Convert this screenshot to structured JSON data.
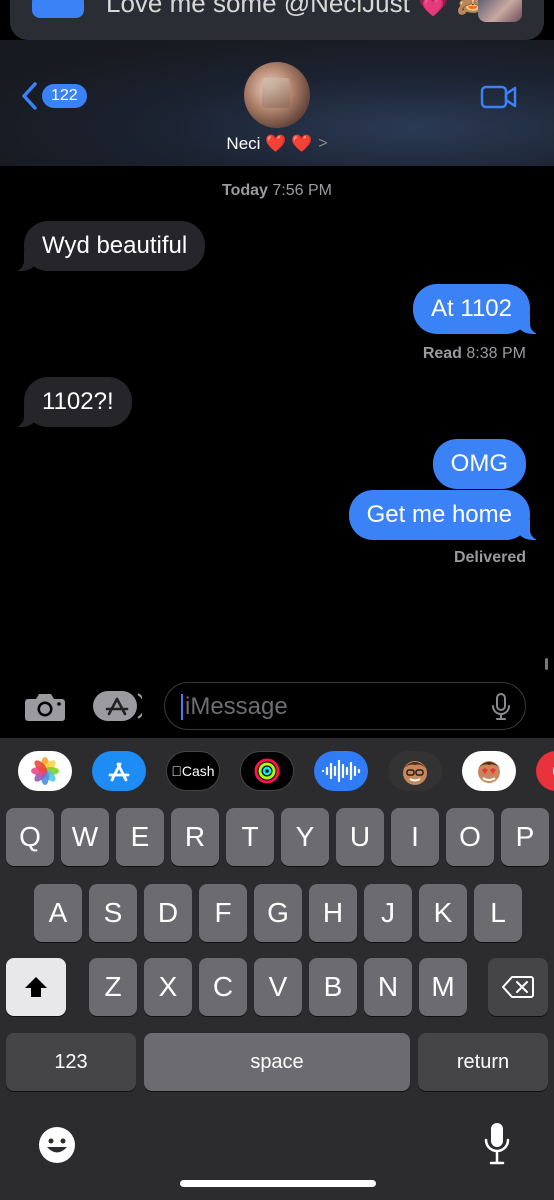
{
  "banner": {
    "text": "Love me some @NeciJust 💗 🙈"
  },
  "header": {
    "back_count": "122",
    "contact_name": "Neci ❤️ ❤️",
    "chevron": ">"
  },
  "thread": {
    "timestamp_day": "Today",
    "timestamp_time": "7:56 PM",
    "messages": [
      {
        "from": "them",
        "text": "Wyd beautiful"
      },
      {
        "from": "me",
        "text": "At 1102"
      },
      {
        "from": "them",
        "text": "1102?!"
      },
      {
        "from": "me",
        "text": "OMG"
      },
      {
        "from": "me",
        "text": "Get me home"
      }
    ],
    "read_label": "Read",
    "read_time": "8:38 PM",
    "delivered_label": "Delivered"
  },
  "composer": {
    "placeholder": "iMessage"
  },
  "app_strip": [
    "photos-icon",
    "app-store-icon",
    "cash-icon",
    "activity-icon",
    "audio-icon",
    "memoji-icon",
    "memoji-stickers-icon",
    "web-search-icon"
  ],
  "app_strip_cash_label": "Cash",
  "keyboard": {
    "row1": [
      "Q",
      "W",
      "E",
      "R",
      "T",
      "Y",
      "U",
      "I",
      "O",
      "P"
    ],
    "row2": [
      "A",
      "S",
      "D",
      "F",
      "G",
      "H",
      "J",
      "K",
      "L"
    ],
    "row3": [
      "Z",
      "X",
      "C",
      "V",
      "B",
      "N",
      "M"
    ],
    "numbers_label": "123",
    "space_label": "space",
    "return_label": "return"
  },
  "colors": {
    "accent": "#3a82f6",
    "incoming_bubble": "#26262a",
    "keyboard_bg": "#2c2c2e"
  }
}
